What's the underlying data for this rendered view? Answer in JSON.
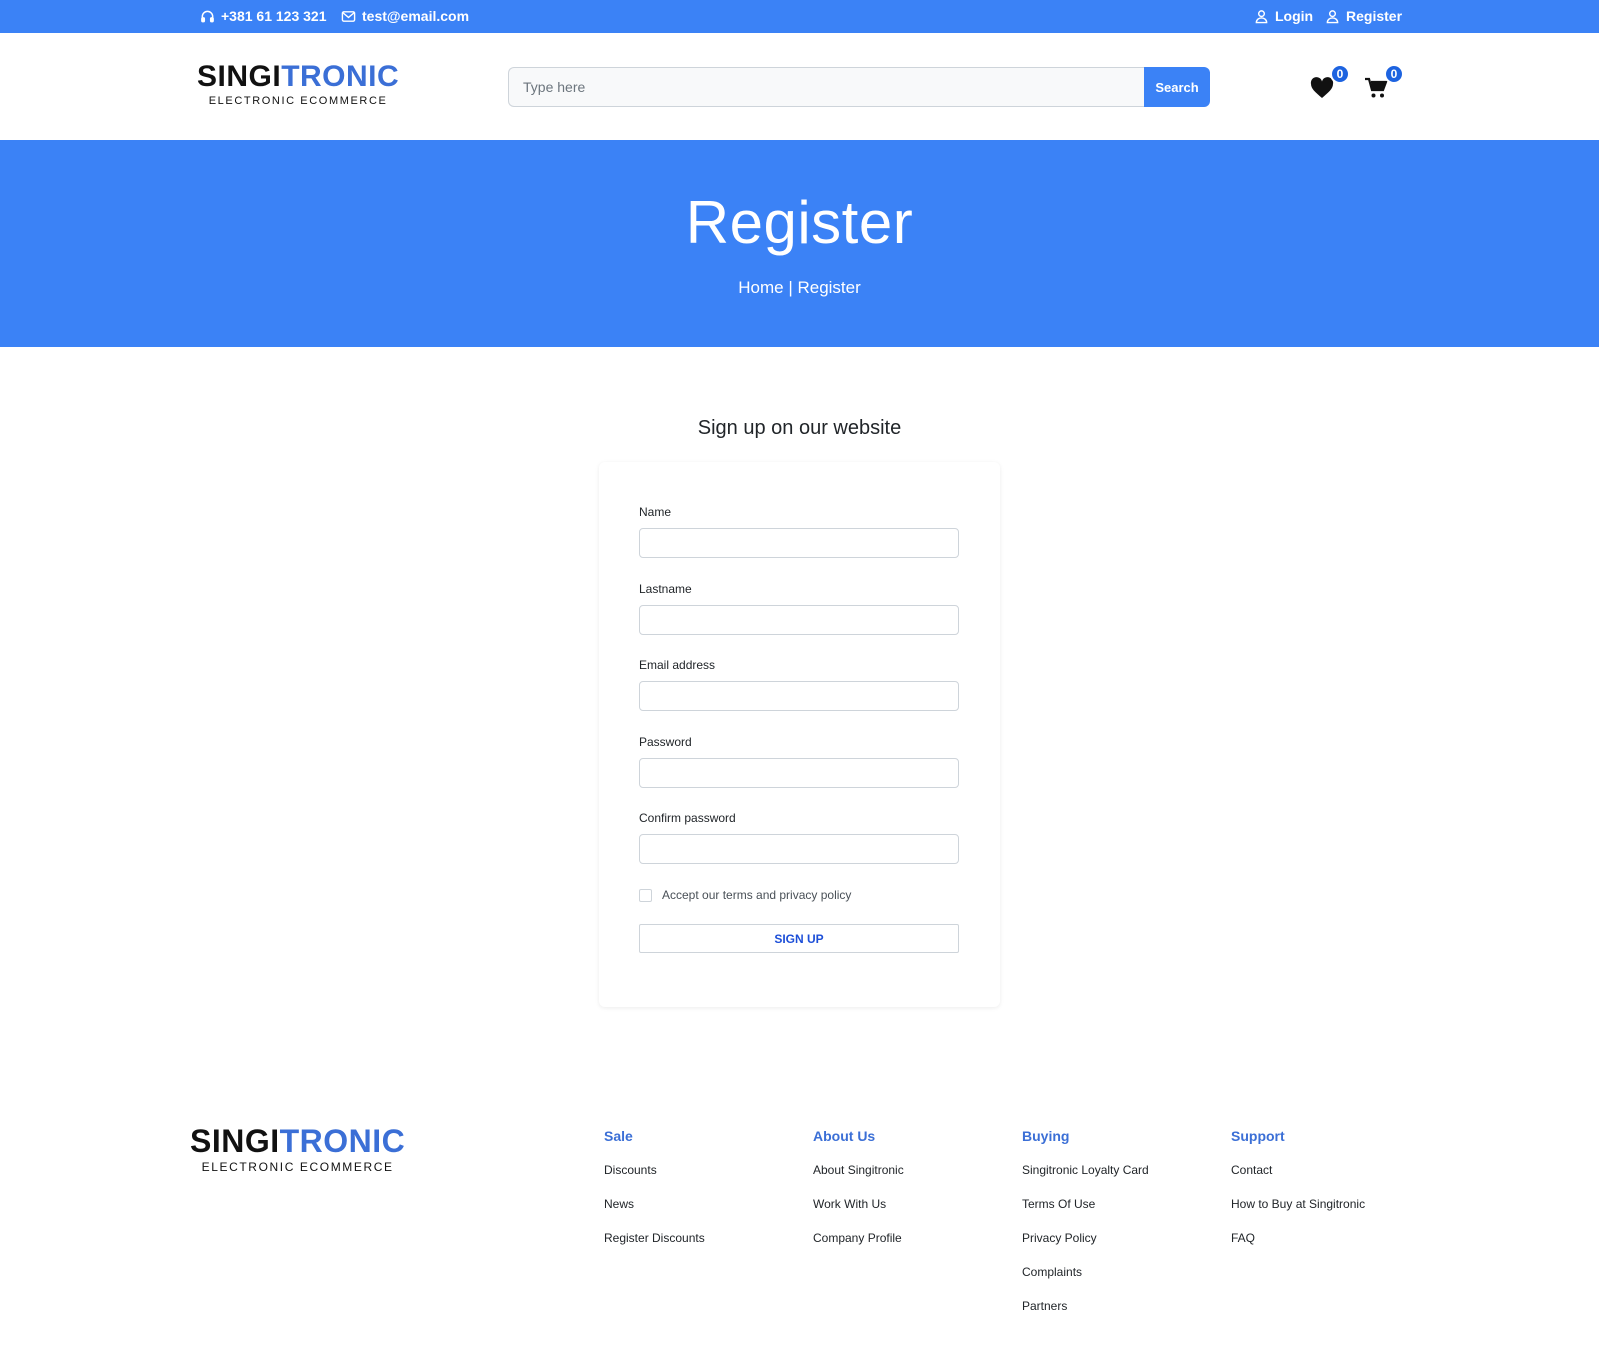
{
  "topbar": {
    "phone": "+381 61 123 321",
    "email": "test@email.com",
    "login": "Login",
    "register": "Register"
  },
  "logo": {
    "part1": "SINGI",
    "part2": "TRONIC",
    "tagline": "ELECTRONIC ECOMMERCE"
  },
  "search": {
    "placeholder": "Type here",
    "button": "Search"
  },
  "counts": {
    "wishlist": "0",
    "cart": "0"
  },
  "hero": {
    "title": "Register",
    "crumb_home": "Home",
    "crumb_sep": "|",
    "crumb_current": "Register"
  },
  "form": {
    "heading": "Sign up on our website",
    "name_label": "Name",
    "lastname_label": "Lastname",
    "email_label": "Email address",
    "password_label": "Password",
    "confirm_label": "Confirm password",
    "terms_label": "Accept our terms and privacy policy",
    "submit": "SIGN UP"
  },
  "footer": {
    "columns": [
      {
        "title": "Sale",
        "links": [
          "Discounts",
          "News",
          "Register Discounts"
        ]
      },
      {
        "title": "About Us",
        "links": [
          "About Singitronic",
          "Work With Us",
          "Company Profile"
        ]
      },
      {
        "title": "Buying",
        "links": [
          "Singitronic Loyalty Card",
          "Terms Of Use",
          "Privacy Policy",
          "Complaints",
          "Partners"
        ]
      },
      {
        "title": "Support",
        "links": [
          "Contact",
          "How to Buy at Singitronic",
          "FAQ"
        ]
      }
    ]
  },
  "colors": {
    "brand_blue": "#3b82f6",
    "logo_blue": "#3b6fd6",
    "badge_blue": "#1d63e0"
  }
}
